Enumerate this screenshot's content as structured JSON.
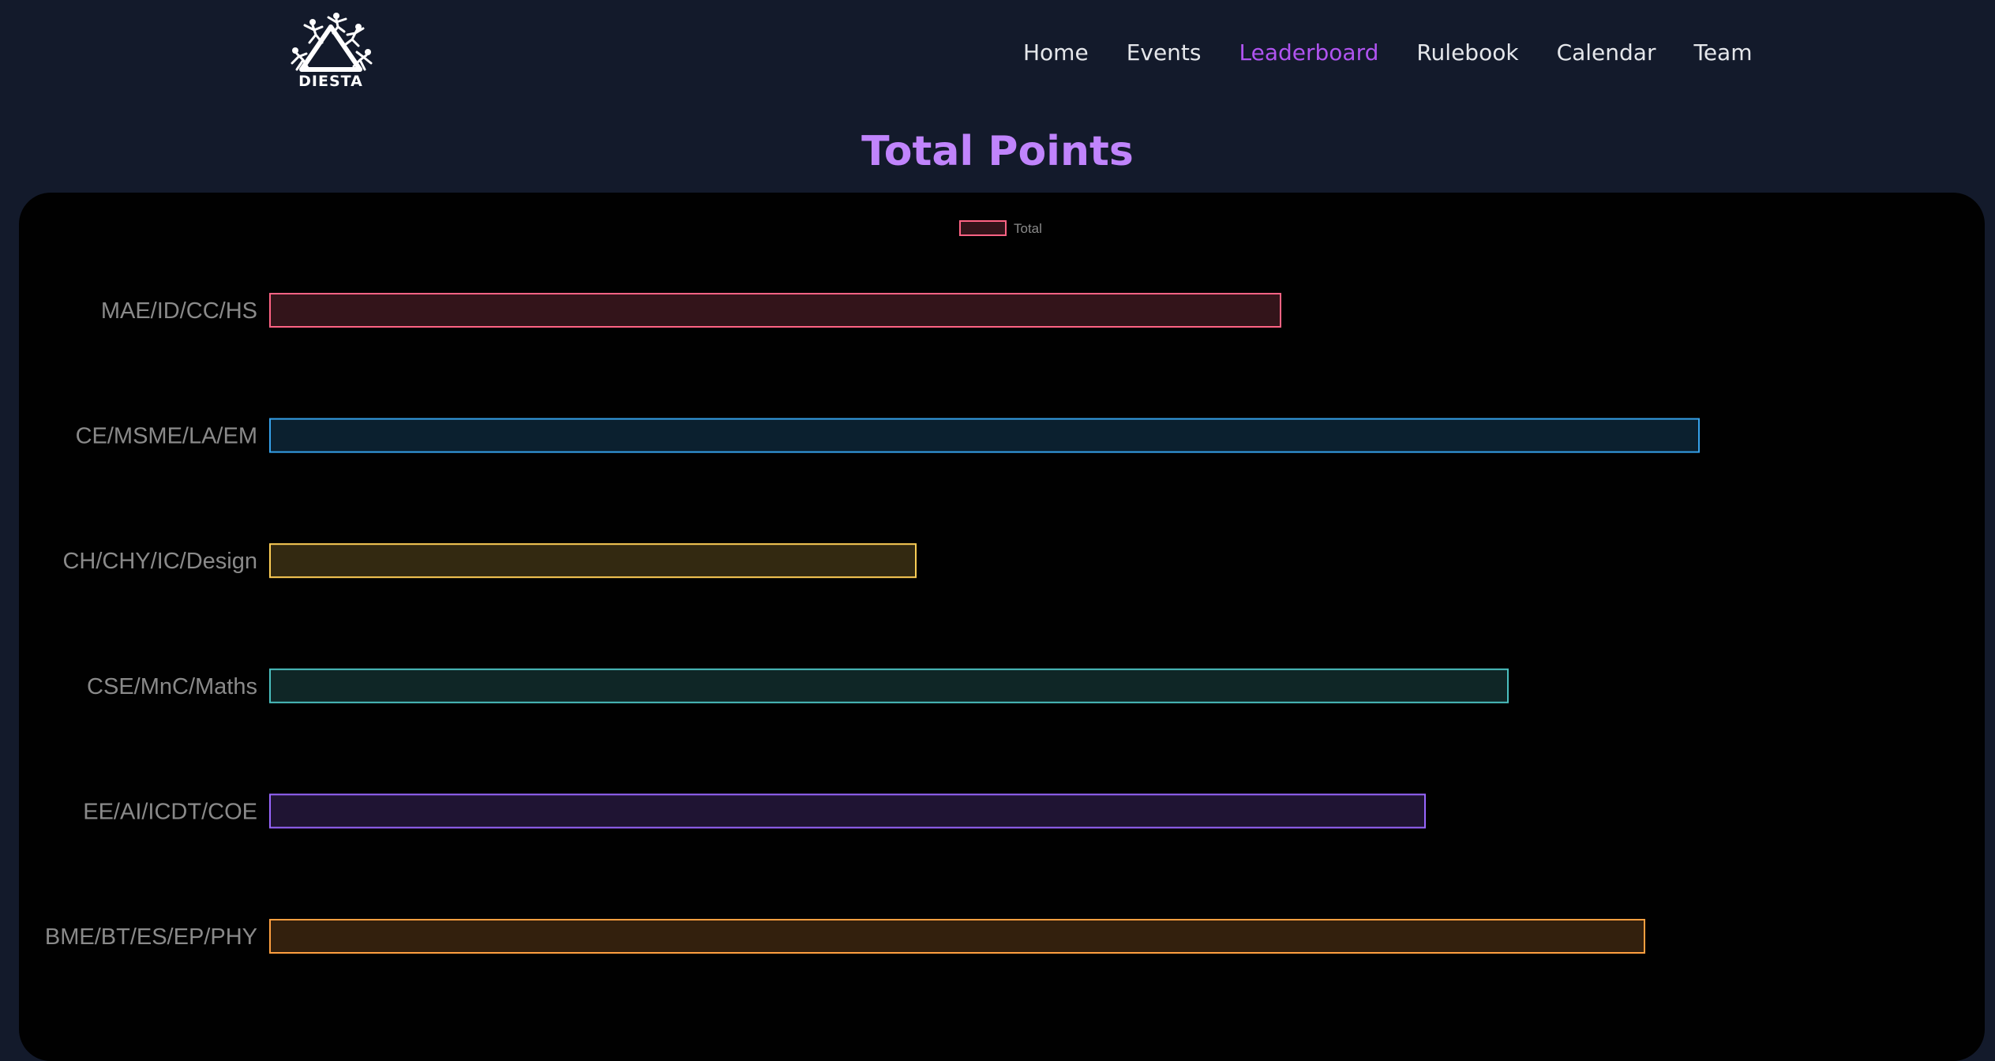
{
  "nav": {
    "logo_text": "DIESTA",
    "links": [
      {
        "label": "Home",
        "active": false
      },
      {
        "label": "Events",
        "active": false
      },
      {
        "label": "Leaderboard",
        "active": true
      },
      {
        "label": "Rulebook",
        "active": false
      },
      {
        "label": "Calendar",
        "active": false
      },
      {
        "label": "Team",
        "active": false
      }
    ],
    "active_color": "#b054f0"
  },
  "page_title": "Total Points",
  "chart_data": {
    "type": "bar",
    "orientation": "horizontal",
    "title": "",
    "xlabel": "",
    "ylabel": "",
    "legend": {
      "label": "Total",
      "placement": "top-center"
    },
    "grid": false,
    "categories": [
      "MAE/ID/CC/HS",
      "CE/MSME/LA/EM",
      "CH/CHY/IC/Design",
      "CSE/MnC/Maths",
      "EE/AI/ICDT/COE",
      "BME/BT/ES/EP/PHY"
    ],
    "series": [
      {
        "name": "Total",
        "values": [
          1280,
          1810,
          818,
          1568,
          1463,
          1741
        ]
      }
    ],
    "xlim": [
      0,
      2100
    ],
    "colors": [
      {
        "border": "#ff6384",
        "fill": "rgba(255, 99, 132, 0.2)"
      },
      {
        "border": "#36a2eb",
        "fill": "rgba(54, 162, 235, 0.2)"
      },
      {
        "border": "#ffce56",
        "fill": "rgba(255, 206, 86, 0.2)"
      },
      {
        "border": "#4bc0c0",
        "fill": "rgba(75, 192, 192, 0.2)"
      },
      {
        "border": "#9966ff",
        "fill": "rgba(153, 102, 255, 0.2)"
      },
      {
        "border": "#ff9f40",
        "fill": "rgba(255, 159, 64, 0.2)"
      }
    ]
  }
}
